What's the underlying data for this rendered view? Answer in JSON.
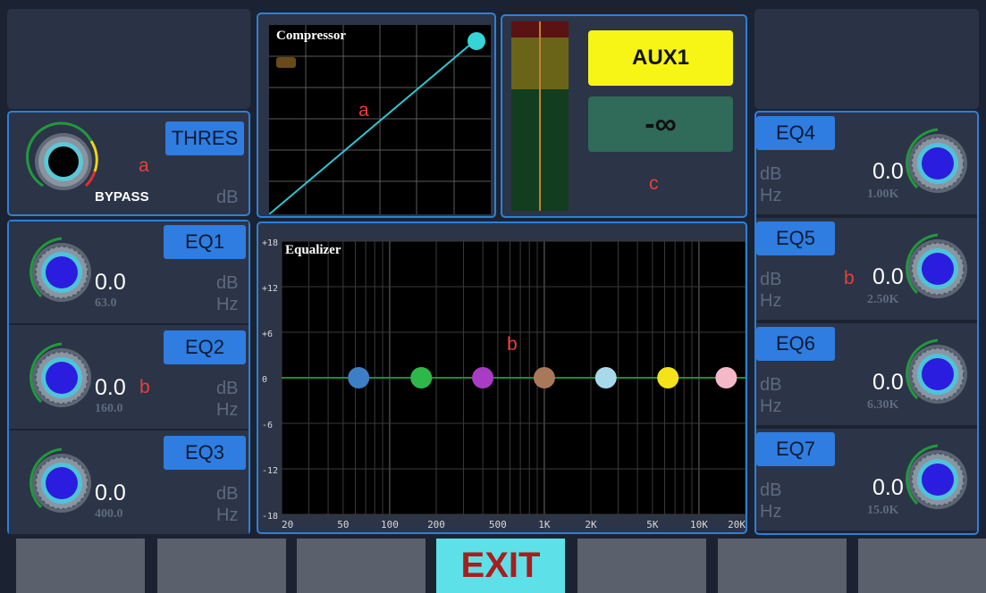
{
  "threshold": {
    "tag": "THRES",
    "bypass": "BYPASS",
    "unit": "dB",
    "marker": "a"
  },
  "eq_left": [
    {
      "tag": "EQ1",
      "value": "0.0",
      "freq": "63.0",
      "unit_db": "dB",
      "unit_hz": "Hz",
      "marker": ""
    },
    {
      "tag": "EQ2",
      "value": "0.0",
      "freq": "160.0",
      "unit_db": "dB",
      "unit_hz": "Hz",
      "marker": "b"
    },
    {
      "tag": "EQ3",
      "value": "0.0",
      "freq": "400.0",
      "unit_db": "dB",
      "unit_hz": "Hz",
      "marker": ""
    }
  ],
  "eq_right": [
    {
      "tag": "EQ4",
      "value": "0.0",
      "freq": "1.00K",
      "unit_db": "dB",
      "unit_hz": "Hz",
      "marker": ""
    },
    {
      "tag": "EQ5",
      "value": "0.0",
      "freq": "2.50K",
      "unit_db": "dB",
      "unit_hz": "Hz",
      "marker": "b"
    },
    {
      "tag": "EQ6",
      "value": "0.0",
      "freq": "6.30K",
      "unit_db": "dB",
      "unit_hz": "Hz",
      "marker": ""
    },
    {
      "tag": "EQ7",
      "value": "0.0",
      "freq": "15.0K",
      "unit_db": "dB",
      "unit_hz": "Hz",
      "marker": ""
    }
  ],
  "compressor": {
    "title": "Compressor",
    "marker": "a"
  },
  "meter": {
    "channel": "AUX1",
    "level": "-∞",
    "marker": "c"
  },
  "equalizer": {
    "title": "Equalizer",
    "marker": "b",
    "y_ticks": [
      "+18",
      "+12",
      "+6",
      "0",
      "-6",
      "-12",
      "-18"
    ],
    "x_ticks": [
      "20",
      "50",
      "100",
      "200",
      "500",
      "1K",
      "2K",
      "5K",
      "10K",
      "20K"
    ]
  },
  "eq_points": [
    {
      "freq": 63,
      "gain": 0,
      "color": "#3d7fc6"
    },
    {
      "freq": 160,
      "gain": 0,
      "color": "#2fb84a"
    },
    {
      "freq": 400,
      "gain": 0,
      "color": "#a93cc4"
    },
    {
      "freq": 1000,
      "gain": 0,
      "color": "#a8785a"
    },
    {
      "freq": 2500,
      "gain": 0,
      "color": "#a7d9ea"
    },
    {
      "freq": 6300,
      "gain": 0,
      "color": "#f5e31a"
    },
    {
      "freq": 15000,
      "gain": 0,
      "color": "#f4b9c8"
    }
  ],
  "bottom_bar": [
    "",
    "",
    "",
    "EXIT",
    "",
    "",
    ""
  ],
  "colors": {
    "accent": "#2d80d8",
    "aux": "#f7f515",
    "level": "#2f6b58",
    "exit": "#5de0e8"
  }
}
